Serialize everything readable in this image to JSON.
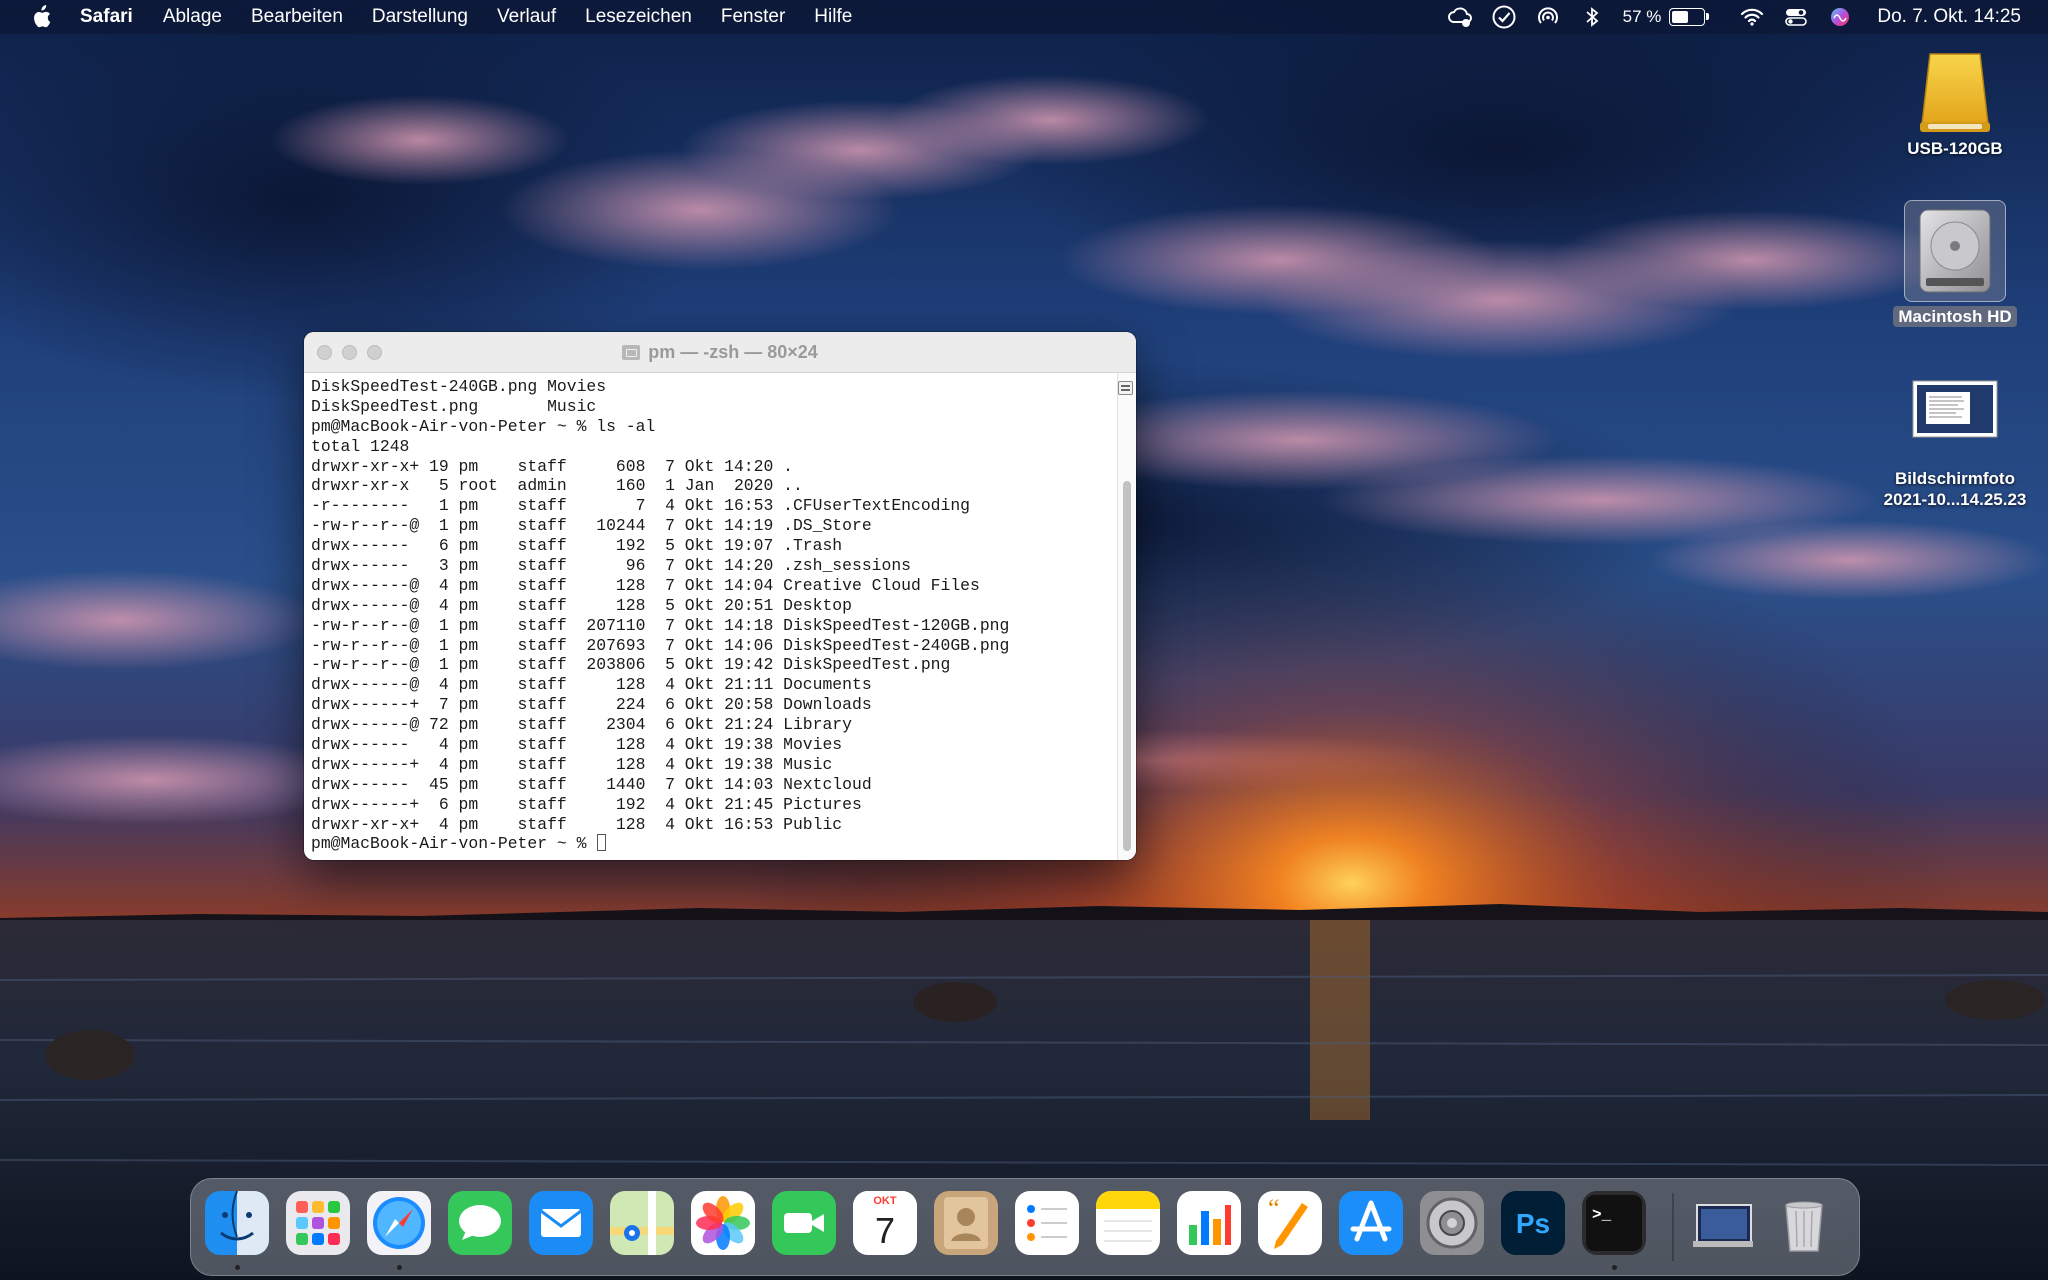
{
  "menubar": {
    "app_name": "Safari",
    "menus": [
      "Ablage",
      "Bearbeiten",
      "Darstellung",
      "Verlauf",
      "Lesezeichen",
      "Fenster",
      "Hilfe"
    ],
    "status_icons": [
      "creative-cloud-icon",
      "checkmark-circle-icon",
      "airdrop-icon",
      "bluetooth-icon"
    ],
    "battery_percent_text": "57 %",
    "battery_level": 0.57,
    "clock": "Do. 7. Okt.  14:25"
  },
  "desktop": {
    "icons": [
      {
        "name": "USB-120GB",
        "label": "USB-120GB",
        "selected": false
      },
      {
        "name": "Macintosh HD",
        "label": "Macintosh HD",
        "selected": true
      },
      {
        "name": "screenshot",
        "label_line1": "Bildschirmfoto",
        "label_line2": "2021-10...14.25.23",
        "selected": false
      }
    ]
  },
  "terminal": {
    "title": "pm — -zsh — 80×24",
    "lines": [
      "DiskSpeedTest-240GB.png Movies",
      "DiskSpeedTest.png       Music",
      "pm@MacBook-Air-von-Peter ~ % ls -al",
      "total 1248",
      "drwxr-xr-x+ 19 pm    staff     608  7 Okt 14:20 .",
      "drwxr-xr-x   5 root  admin     160  1 Jan  2020 ..",
      "-r--------   1 pm    staff       7  4 Okt 16:53 .CFUserTextEncoding",
      "-rw-r--r--@  1 pm    staff   10244  7 Okt 14:19 .DS_Store",
      "drwx------   6 pm    staff     192  5 Okt 19:07 .Trash",
      "drwx------   3 pm    staff      96  7 Okt 14:20 .zsh_sessions",
      "drwx------@  4 pm    staff     128  7 Okt 14:04 Creative Cloud Files",
      "drwx------@  4 pm    staff     128  5 Okt 20:51 Desktop",
      "-rw-r--r--@  1 pm    staff  207110  7 Okt 14:18 DiskSpeedTest-120GB.png",
      "-rw-r--r--@  1 pm    staff  207693  7 Okt 14:06 DiskSpeedTest-240GB.png",
      "-rw-r--r--@  1 pm    staff  203806  5 Okt 19:42 DiskSpeedTest.png",
      "drwx------@  4 pm    staff     128  4 Okt 21:11 Documents",
      "drwx------+  7 pm    staff     224  6 Okt 20:58 Downloads",
      "drwx------@ 72 pm    staff    2304  6 Okt 21:24 Library",
      "drwx------   4 pm    staff     128  4 Okt 19:38 Movies",
      "drwx------+  4 pm    staff     128  4 Okt 19:38 Music",
      "drwx------  45 pm    staff    1440  7 Okt 14:03 Nextcloud",
      "drwx------+  6 pm    staff     192  4 Okt 21:45 Pictures",
      "drwxr-xr-x+  4 pm    staff     128  4 Okt 16:53 Public"
    ],
    "prompt": "pm@MacBook-Air-von-Peter ~ % "
  },
  "dock": {
    "apps": [
      {
        "id": "finder",
        "running": true
      },
      {
        "id": "launchpad",
        "running": false
      },
      {
        "id": "safari",
        "running": true
      },
      {
        "id": "messages",
        "running": false
      },
      {
        "id": "mail",
        "running": false
      },
      {
        "id": "maps",
        "running": false
      },
      {
        "id": "photos",
        "running": false
      },
      {
        "id": "facetime",
        "running": false
      },
      {
        "id": "calendar",
        "running": false,
        "month": "OKT",
        "day": "7"
      },
      {
        "id": "contacts",
        "running": false
      },
      {
        "id": "reminders",
        "running": false
      },
      {
        "id": "notes",
        "running": false
      },
      {
        "id": "numbers",
        "running": false
      },
      {
        "id": "pages",
        "running": false
      },
      {
        "id": "app-store",
        "running": false
      },
      {
        "id": "system-preferences",
        "running": false
      },
      {
        "id": "photoshop",
        "running": false,
        "label": "Ps"
      },
      {
        "id": "terminal",
        "running": true,
        "label": ">_"
      },
      {
        "id": "downloads-stack",
        "running": false
      },
      {
        "id": "trash",
        "running": false
      }
    ]
  },
  "colors": {
    "menubar_bg": "#0c1634",
    "terminal_bg": "#ffffff",
    "terminal_text": "#1a1a1a"
  }
}
